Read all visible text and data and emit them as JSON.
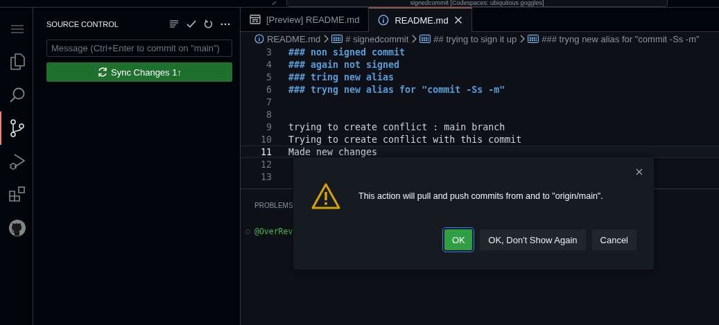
{
  "title_bar": {
    "title": "signedcommit [Codespaces: ubiquitous goggles]"
  },
  "activity_bar": {
    "items": [
      {
        "kind": "menu",
        "selected": false
      },
      {
        "kind": "explorer",
        "selected": false
      },
      {
        "kind": "search",
        "selected": false
      },
      {
        "kind": "source-control",
        "selected": true
      },
      {
        "kind": "run-debug",
        "selected": false
      },
      {
        "kind": "extensions",
        "selected": false
      },
      {
        "kind": "github",
        "selected": false
      }
    ]
  },
  "sidebar": {
    "title": "SOURCE CONTROL",
    "message": {
      "placeholder": "Message (Ctrl+Enter to commit on \"main\")"
    },
    "sync_button": {
      "label": "Sync Changes 1↑"
    }
  },
  "tabs": [
    {
      "label": "[Preview] README.md",
      "kind": "preview",
      "selected": false
    },
    {
      "label": "README.md",
      "kind": "info",
      "selected": true
    }
  ],
  "breadcrumbs": [
    {
      "label": "README.md",
      "kind": "file"
    },
    {
      "label": "# signedcommit",
      "kind": "heading"
    },
    {
      "label": "## trying to sign it up",
      "kind": "heading"
    },
    {
      "label": "### tryng new alias for \"commit -Ss -m\"",
      "kind": "heading"
    }
  ],
  "editor_lines": [
    {
      "number": "3",
      "text": "### non signed commit",
      "kind": "heading",
      "current": false
    },
    {
      "number": "4",
      "text": "### again not signed",
      "kind": "heading",
      "current": false
    },
    {
      "number": "5",
      "text": "### tring new alias",
      "kind": "heading",
      "current": false
    },
    {
      "number": "6",
      "text": "### tryng new alias for \"commit -Ss -m\"",
      "kind": "heading",
      "current": false
    },
    {
      "number": "7",
      "kind": "text",
      "current": false
    },
    {
      "number": "8",
      "kind": "text",
      "current": false
    },
    {
      "number": "9",
      "text": "trying to create conflict : main branch",
      "kind": "text",
      "current": false
    },
    {
      "number": "10",
      "text": "Trying to create conflict with this commit",
      "kind": "text",
      "current": false
    },
    {
      "number": "11",
      "text": "Made new changes",
      "kind": "text",
      "current": true
    },
    {
      "number": "12",
      "kind": "text",
      "current": false
    },
    {
      "number": "13",
      "kind": "text",
      "current": false
    }
  ],
  "panel": {
    "tabs": [
      {
        "label": "PROBLEMS"
      }
    ],
    "terminal_line": "@OverRev"
  },
  "dialog": {
    "message": "This action will pull and push commits from and to \"origin/main\".",
    "buttons": [
      {
        "label": "OK",
        "kind": "primary"
      },
      {
        "label": "OK, Don't Show Again",
        "kind": "secondary"
      },
      {
        "label": "Cancel",
        "kind": "secondary"
      }
    ]
  }
}
